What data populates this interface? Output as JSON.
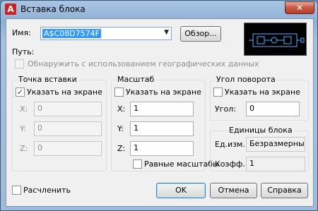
{
  "window": {
    "title": "Вставка блока",
    "close_label": "✕"
  },
  "name": {
    "label": "Имя:",
    "value": "A$C08D7574F",
    "browse_button": "Обзор..."
  },
  "path": {
    "label": "Путь:",
    "geo_checkbox": "Обнаружить с использованием географических данных"
  },
  "insertion_point": {
    "title": "Точка вставки",
    "specify_on_screen": "Указать на экране",
    "specify_checked": true,
    "x_label": "X:",
    "x_value": "0",
    "y_label": "Y:",
    "y_value": "0",
    "z_label": "Z:",
    "z_value": "0"
  },
  "scale": {
    "title": "Масштаб",
    "specify_on_screen": "Указать на экране",
    "specify_checked": false,
    "x_label": "X:",
    "x_value": "1",
    "y_label": "Y:",
    "y_value": "1",
    "z_label": "Z:",
    "z_value": "1",
    "uniform_scale": "Равные масштабы"
  },
  "rotation": {
    "title": "Угол поворота",
    "specify_on_screen": "Указать на экране",
    "angle_label": "Угол:",
    "angle_value": "0"
  },
  "block_units": {
    "title": "Единицы блока",
    "unit_label": "Ед.изм.:",
    "unit_value": "Безразмерный",
    "factor_label": "Коэфф.:",
    "factor_value": "1"
  },
  "explode_checkbox": "Расчленить",
  "buttons": {
    "ok": "OK",
    "cancel": "Отмена",
    "help": "Справка"
  }
}
